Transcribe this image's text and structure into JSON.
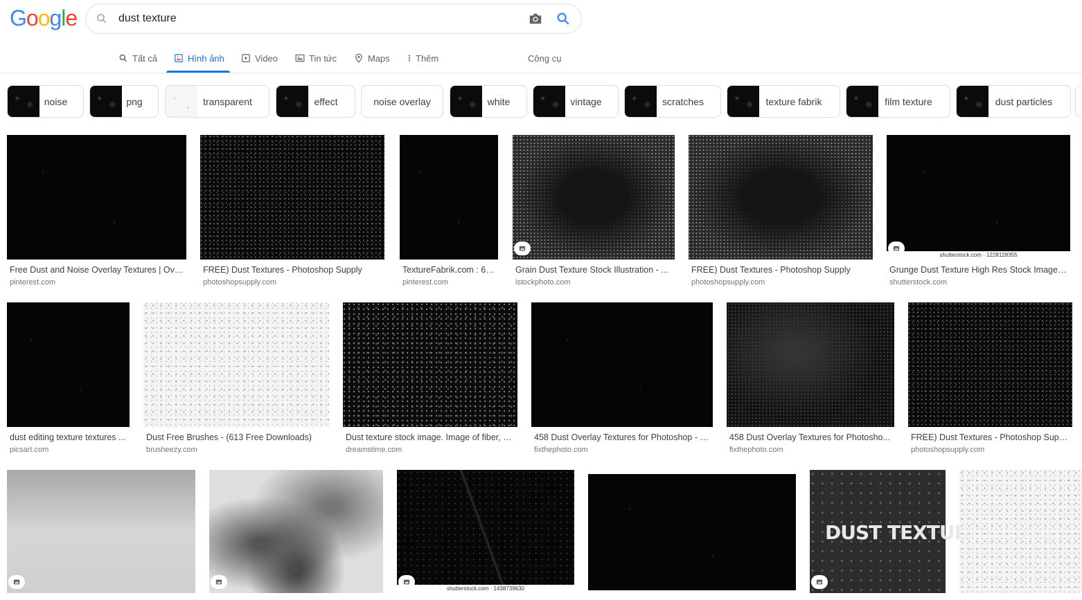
{
  "logo": {
    "letters": [
      "G",
      "o",
      "o",
      "g",
      "l",
      "e"
    ],
    "colors": [
      "#4285f4",
      "#ea4335",
      "#fbbc05",
      "#4285f4",
      "#34a853",
      "#ea4335"
    ]
  },
  "search": {
    "query": "dust texture"
  },
  "tabs": [
    {
      "label": "Tất cả",
      "icon": "search-icon",
      "active": false
    },
    {
      "label": "Hình ảnh",
      "icon": "image-icon",
      "active": true
    },
    {
      "label": "Video",
      "icon": "video-icon",
      "active": false
    },
    {
      "label": "Tin tức",
      "icon": "news-icon",
      "active": false
    },
    {
      "label": "Maps",
      "icon": "map-pin-icon",
      "active": false
    },
    {
      "label": "Thêm",
      "icon": "more-vert-icon",
      "active": false
    }
  ],
  "tools_label": "Công cụ",
  "chips": [
    {
      "label": "noise",
      "thumb": "dark"
    },
    {
      "label": "png",
      "thumb": "dark"
    },
    {
      "label": "transparent",
      "thumb": "light"
    },
    {
      "label": "effect",
      "thumb": "dark"
    },
    {
      "label": "noise overlay",
      "thumb": "none"
    },
    {
      "label": "white",
      "thumb": "dark"
    },
    {
      "label": "vintage",
      "thumb": "dark"
    },
    {
      "label": "scratches",
      "thumb": "dark"
    },
    {
      "label": "texture fabrik",
      "thumb": "dark"
    },
    {
      "label": "film texture",
      "thumb": "dark"
    },
    {
      "label": "dust particles",
      "thumb": "dark"
    }
  ],
  "results": [
    {
      "title": "Free Dust and Noise Overlay Textures | Ove...",
      "source": "pinterest.com",
      "tone": "black"
    },
    {
      "title": "FREE) Dust Textures - Photoshop Supply",
      "source": "photoshopsupply.com",
      "tone": "specks"
    },
    {
      "title": "TextureFabrik.com : 6 ...",
      "source": "pinterest.com",
      "tone": "black"
    },
    {
      "title": "Grain Dust Texture Stock Illustration - ...",
      "source": "istockphoto.com",
      "tone": "grunge",
      "badge": true
    },
    {
      "title": "FREE) Dust Textures - Photoshop Supply",
      "source": "photoshopsupply.com",
      "tone": "grunge"
    },
    {
      "title": "Grunge Dust Texture High Res Stock Images ...",
      "source": "shutterstock.com",
      "tone": "black",
      "badge": true,
      "watermark": "shutterstock.com · 1228128355"
    },
    {
      "title": "dust editing texture textures ...",
      "source": "picsart.com",
      "tone": "black"
    },
    {
      "title": "Dust Free Brushes - (613 Free Downloads)",
      "source": "brusheezy.com",
      "tone": "white"
    },
    {
      "title": "Dust texture stock image. Image of fiber, a...",
      "source": "dreamstime.com",
      "tone": "fibers"
    },
    {
      "title": "458 Dust Overlay Textures for Photoshop - (...",
      "source": "fixthephoto.com",
      "tone": "black"
    },
    {
      "title": "458 Dust Overlay Textures for Photosho...",
      "source": "fixthephoto.com",
      "tone": "cloudy"
    },
    {
      "title": "FREE) Dust Textures - Photoshop Supply",
      "source": "photoshopsupply.com",
      "tone": "specks"
    },
    {
      "title": "",
      "source": "",
      "tone": "gray",
      "badge": true
    },
    {
      "title": "",
      "source": "",
      "tone": "smoke",
      "badge": true
    },
    {
      "title": "",
      "source": "",
      "tone": "scratch",
      "badge": true,
      "watermark": "shutterstock.com · 1438739630"
    },
    {
      "title": "",
      "source": "",
      "tone": "black"
    },
    {
      "title": "",
      "source": "",
      "tone": "dusttext",
      "badge": true,
      "overlay_text": "DUST TEXTURE"
    },
    {
      "title": "",
      "source": "",
      "tone": "white"
    }
  ]
}
